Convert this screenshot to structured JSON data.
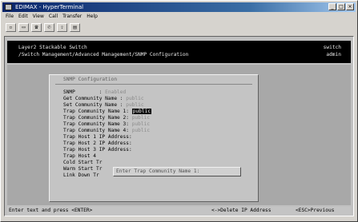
{
  "window": {
    "title": "EDIMAX - HyperTerminal"
  },
  "menu": [
    "File",
    "Edit",
    "View",
    "Call",
    "Transfer",
    "Help"
  ],
  "toolbar": [
    "new-icon",
    "open-icon",
    "dial-icon",
    "hangup-icon",
    "send-icon",
    "properties-icon"
  ],
  "header": {
    "line1": "Layer2 Stackable Switch",
    "line2": "/Switch Management/Advanced Management/SNMP Configuration",
    "right1": "switch",
    "right2": "admin"
  },
  "panel": {
    "title": "SNMP Configuration",
    "fields": [
      {
        "label": "SNMP        : ",
        "value": "Enabled"
      },
      {
        "label": "Get Community Name : ",
        "value": "public"
      },
      {
        "label": "Set Community Name : ",
        "value": "public"
      },
      {
        "label": "Trap Community Name 1: ",
        "value": "public",
        "selected": true
      },
      {
        "label": "Trap Community Name 2: ",
        "value": "public"
      },
      {
        "label": "Trap Community Name 3: ",
        "value": "public"
      },
      {
        "label": "Trap Community Name 4: ",
        "value": "public"
      },
      {
        "label": "Trap Host 1 IP Address: ",
        "value": ""
      },
      {
        "label": "Trap Host 2 IP Address: ",
        "value": ""
      },
      {
        "label": "Trap Host 3 IP Address: ",
        "value": ""
      },
      {
        "label": "Trap Host 4",
        "value": ""
      },
      {
        "label": "Cold Start Tr",
        "value": ""
      },
      {
        "label": "Warm Start Tr",
        "value": ""
      },
      {
        "label": "Link Down Tr",
        "value": ""
      }
    ],
    "prompt": "Enter Trap Community Name 1:"
  },
  "status": {
    "left": "Enter text and press <ENTER>",
    "middle": "<->Delete IP Address",
    "right": "<ESC>Previous"
  }
}
